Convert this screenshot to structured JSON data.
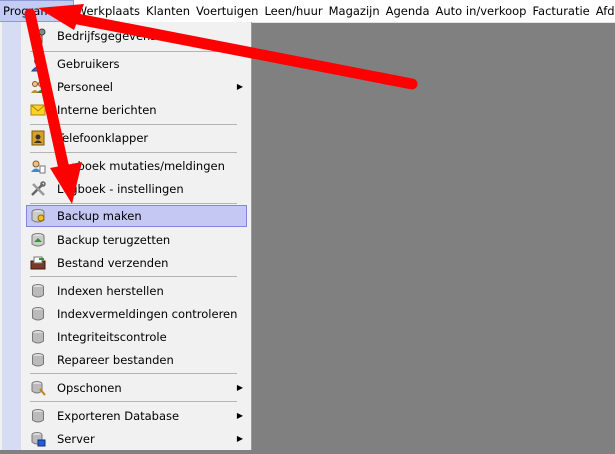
{
  "menubar": {
    "items": [
      "Programma",
      "Werkplaats",
      "Klanten",
      "Voertuigen",
      "Leen/huur",
      "Magazijn",
      "Agenda",
      "Auto in/verkoop",
      "Facturatie",
      "Afdrukken"
    ]
  },
  "menu": {
    "items": [
      {
        "label": "Bedrijfsgegevens",
        "icon": "building-gear-icon"
      },
      {
        "label": "Gebruikers",
        "icon": "user-icon"
      },
      {
        "label": "Personeel",
        "icon": "staff-icon",
        "submenu": true
      },
      {
        "label": "Interne berichten",
        "icon": "envelope-icon"
      },
      {
        "label": "Telefoonklapper",
        "icon": "phonebook-icon"
      },
      {
        "label": "Logboek mutaties/meldingen",
        "icon": "log-icon"
      },
      {
        "label": "Logboek - instellingen",
        "icon": "tools-icon"
      },
      {
        "label": "Backup maken",
        "icon": "backup-icon"
      },
      {
        "label": "Backup terugzetten",
        "icon": "restore-icon"
      },
      {
        "label": "Bestand verzenden",
        "icon": "send-file-icon"
      },
      {
        "label": "Indexen herstellen",
        "icon": "database-icon"
      },
      {
        "label": "Indexvermeldingen controleren",
        "icon": "database-icon"
      },
      {
        "label": "Integriteitscontrole",
        "icon": "database-icon"
      },
      {
        "label": "Repareer bestanden",
        "icon": "database-icon"
      },
      {
        "label": "Opschonen",
        "icon": "cleanup-icon",
        "submenu": true
      },
      {
        "label": "Exporteren Database",
        "icon": "database-icon",
        "submenu": true
      },
      {
        "label": "Server",
        "icon": "server-icon",
        "submenu": true
      }
    ],
    "highlighted": "Backup maken"
  },
  "colors": {
    "annotation_arrow": "#ff0000",
    "highlight": "#c4c8f3",
    "workspace": "#808080"
  }
}
